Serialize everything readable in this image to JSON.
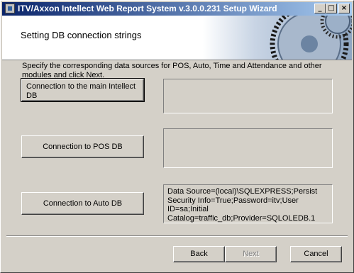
{
  "window": {
    "title": "ITV/Axxon Intellect Web Report System v.3.0.0.231 Setup Wizard"
  },
  "titlebar_buttons": {
    "minimize": "_",
    "maximize": "□",
    "close": "×"
  },
  "header": {
    "title": "Setting DB connection strings"
  },
  "description": "Specify the corresponding data sources for POS, Auto, Time and Attendance and other modules and click Next.",
  "connections": [
    {
      "button_label": "Connection to the main Intellect DB",
      "value": ""
    },
    {
      "button_label": "Connection to POS DB",
      "value": ""
    },
    {
      "button_label": "Connection to Auto DB",
      "value": "Data Source=(local)\\SQLEXPRESS;Persist Security Info=True;Password=itv;User ID=sa;Initial Catalog=traffic_db;Provider=SQLOLEDB.1"
    }
  ],
  "footer": {
    "back_label": "Back",
    "next_label": "Next",
    "next_enabled": false,
    "cancel_label": "Cancel"
  },
  "colors": {
    "title_gradient_start": "#0a246a",
    "title_gradient_end": "#a6caf0",
    "face": "#d4d0c8"
  }
}
